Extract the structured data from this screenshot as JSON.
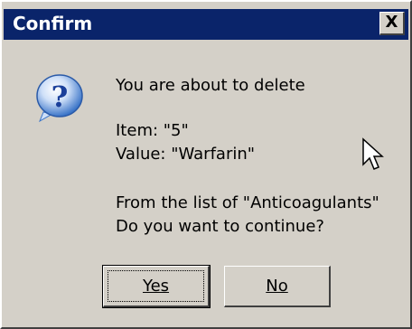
{
  "window": {
    "title": "Confirm",
    "close_symbol": "X"
  },
  "icon": {
    "name": "question-icon",
    "glyph": "?"
  },
  "message": {
    "line1": "You are about to delete",
    "line2": "Item: \"5\"",
    "line3": "Value: \"Warfarin\"",
    "line4": "From the list of \"Anticoagulants\"",
    "line5": "Do you want to continue?"
  },
  "buttons": {
    "yes_label": "Yes",
    "no_label": "No"
  },
  "colors": {
    "title_bar": "#0a246a",
    "dialog_face": "#d4d0c8",
    "icon_blue": "#2f6fd6"
  }
}
